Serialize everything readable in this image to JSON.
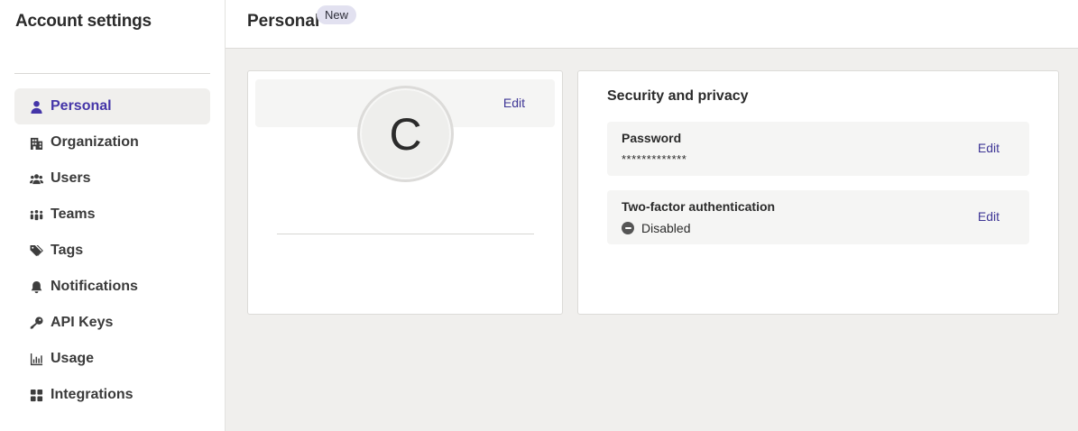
{
  "sidebar": {
    "title": "Account settings",
    "items": [
      {
        "label": "Personal",
        "icon": "user-icon",
        "active": true
      },
      {
        "label": "Organization",
        "icon": "building-icon",
        "active": false
      },
      {
        "label": "Users",
        "icon": "users-icon",
        "active": false
      },
      {
        "label": "Teams",
        "icon": "teams-icon",
        "active": false
      },
      {
        "label": "Tags",
        "icon": "tag-icon",
        "active": false
      },
      {
        "label": "Notifications",
        "icon": "bell-icon",
        "active": false
      },
      {
        "label": "API Keys",
        "icon": "key-icon",
        "active": false
      },
      {
        "label": "Usage",
        "icon": "chart-icon",
        "active": false
      },
      {
        "label": "Integrations",
        "icon": "grid-icon",
        "active": false
      }
    ]
  },
  "header": {
    "title": "Personal",
    "badge": "New"
  },
  "profile": {
    "avatar_letter": "C",
    "edit_label": "Edit"
  },
  "security": {
    "title": "Security and privacy",
    "password": {
      "label": "Password",
      "value": "*************",
      "edit_label": "Edit"
    },
    "two_factor": {
      "label": "Two-factor authentication",
      "status": "Disabled",
      "edit_label": "Edit"
    }
  },
  "colors": {
    "accent": "#4435a8",
    "link": "#3f3796",
    "background": "#f0efed",
    "badge_bg": "#e2e1f0"
  }
}
